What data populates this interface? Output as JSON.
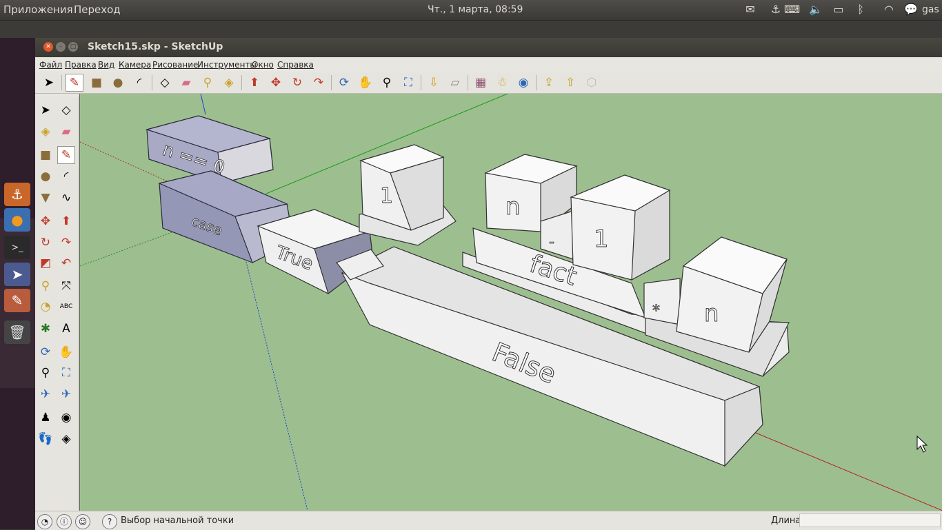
{
  "top_panel": {
    "apps_menu": "Приложения",
    "places_menu": "Переход",
    "clock": "Чт., 1 марта, 08:59",
    "user": "gas",
    "tray_icons": [
      "mail-icon",
      "anchor-icon",
      "keyboard-icon",
      "volume-icon",
      "battery-icon",
      "bluetooth-icon",
      "wifi-icon",
      "chat-icon"
    ]
  },
  "launcher": {
    "items": [
      "anchor-icon",
      "firefox-icon",
      "terminal-icon",
      "pointer-app-icon",
      "sketchup-icon",
      "trash-icon"
    ]
  },
  "window": {
    "title": "Sketch15.skp - SketchUp",
    "menu": [
      "Файл",
      "Правка",
      "Вид",
      "Камера",
      "Рисование",
      "Инструменты",
      "Окно",
      "Справка"
    ]
  },
  "model_labels": {
    "condition": "n == 0",
    "case": "case",
    "true": "True",
    "one": "1",
    "n": "n",
    "minus": "-",
    "one_b": "1",
    "fact": "fact",
    "times": "*",
    "n_b": "n",
    "false": "False"
  },
  "status": {
    "text": "Выбор начальной точки",
    "measure_label": "Длина",
    "measure_value": ""
  }
}
